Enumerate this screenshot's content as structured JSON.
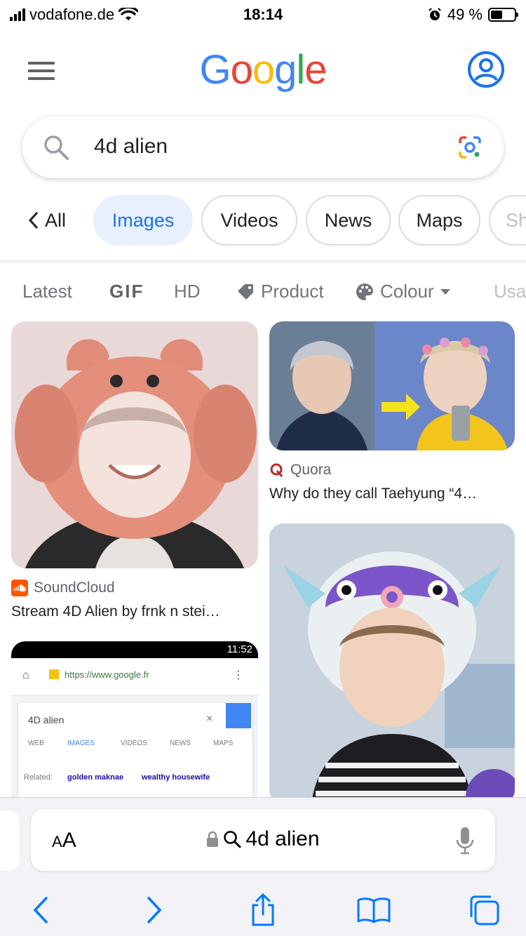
{
  "status_bar": {
    "carrier": "vodafone.de",
    "time": "18:14",
    "battery": "49 %",
    "battery_level": 0.49
  },
  "header": {
    "logo_letters": [
      {
        "char": "G",
        "color": "#4285F4"
      },
      {
        "char": "o",
        "color": "#EA4335"
      },
      {
        "char": "o",
        "color": "#FBBC05"
      },
      {
        "char": "g",
        "color": "#4285F4"
      },
      {
        "char": "l",
        "color": "#34A853"
      },
      {
        "char": "e",
        "color": "#EA4335"
      }
    ],
    "menu_icon": "hamburger-menu-icon",
    "account_icon": "account-circle-icon"
  },
  "search": {
    "query": "4d alien",
    "search_icon": "search-icon",
    "lens_icon": "google-lens-icon"
  },
  "tabs": {
    "back": "All",
    "items": [
      "Images",
      "Videos",
      "News",
      "Maps",
      "Sh"
    ],
    "active": "Images"
  },
  "filters": {
    "items": [
      "Latest",
      "GIF",
      "HD",
      "Product",
      "Colour",
      "Usa"
    ]
  },
  "results": [
    {
      "source": "SoundCloud",
      "title": "Stream 4D Alien by frnk n stei…",
      "source_color": "#FF5500"
    },
    {
      "source": "Quora",
      "title": "Why do they call Taehyung “4…",
      "source_color": "#B92B27"
    },
    {
      "screenshot_thumb": {
        "status": "11:52",
        "url": "https://www.google.fr",
        "query": "4D alien",
        "tabs": [
          "WEB",
          "IMAGES",
          "VIDEOS",
          "NEWS",
          "MAPS"
        ],
        "related_label": "Related:",
        "related": [
          "golden maknae",
          "wealthy housewife"
        ]
      }
    }
  ],
  "safari": {
    "text_size": "AA",
    "address": "4d alien",
    "icons": [
      "back-arrow-icon",
      "forward-arrow-icon",
      "share-icon",
      "bookmarks-icon",
      "tabs-icon"
    ]
  },
  "colors": {
    "accent": "#1a73e8",
    "active_tab_bg": "#e8f0fe",
    "safari_blue": "#007aff"
  }
}
